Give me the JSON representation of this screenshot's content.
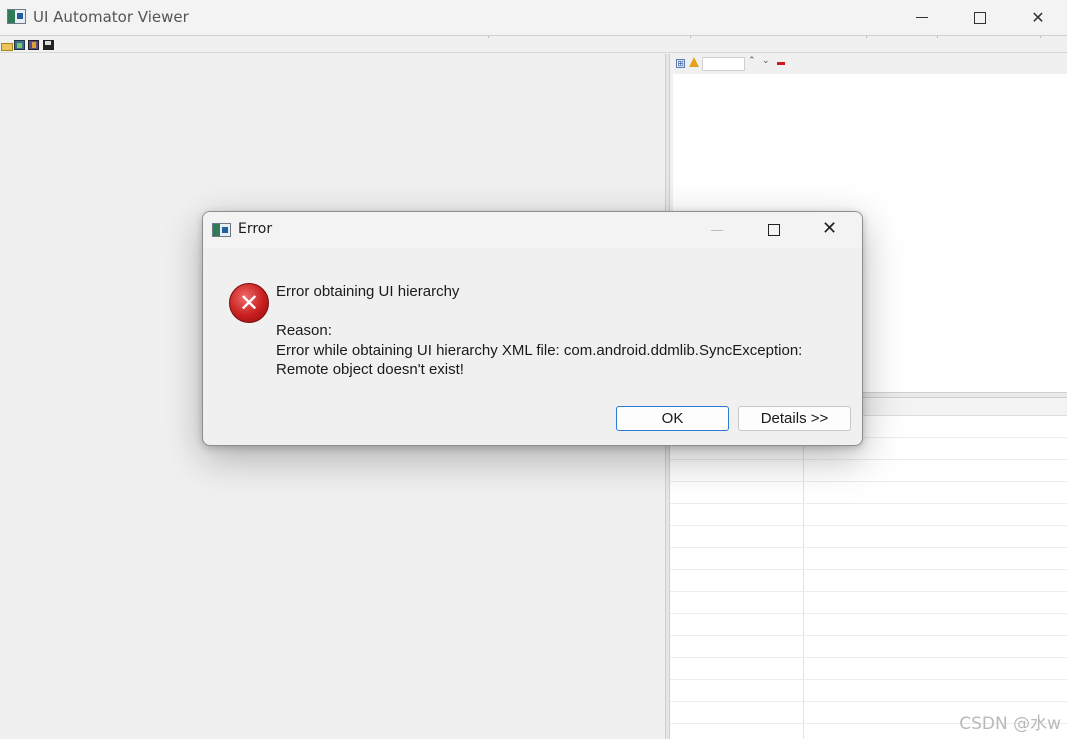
{
  "window": {
    "title": "UI Automator Viewer",
    "icon": "uiautomatorviewer-app-icon",
    "controls": {
      "minimize": "minimize-icon",
      "maximize": "maximize-icon",
      "close": "close-icon"
    },
    "close_glyph": "✕"
  },
  "toolbar": {
    "icons": [
      "open-folder-icon",
      "device-screenshot-icon",
      "compressed-hierarchy-icon",
      "save-icon"
    ]
  },
  "tree_toolbar": {
    "expand_glyph": "⊞",
    "up_glyph": "⌃",
    "down_glyph": "⌄",
    "search_value": ""
  },
  "dialog": {
    "title": "Error",
    "icon": "error-icon",
    "error_glyph": "✕",
    "close_glyph": "✕",
    "message_title": "Error obtaining UI hierarchy",
    "reason_label": "Reason:",
    "reason_line1": "Error while obtaining UI hierarchy XML file: com.android.ddmlib.SyncException:",
    "reason_line2": "Remote object doesn't exist!",
    "ok_label": "OK",
    "details_label": "Details >>"
  },
  "watermark": "CSDN @水w",
  "colors": {
    "dialog_bg": "#f0f0f0",
    "ok_border": "#2a7ad6",
    "error_red": "#c81e1e"
  }
}
